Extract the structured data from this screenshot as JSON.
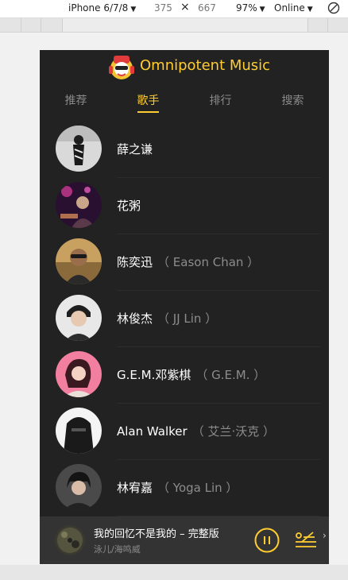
{
  "devtools": {
    "device": "iPhone 6/7/8",
    "width": "375",
    "times": "×",
    "height": "667",
    "zoom": "97%",
    "network": "Online",
    "caret": "▼"
  },
  "app": {
    "title": "Omnipotent Music"
  },
  "tabs": [
    {
      "label": "推荐"
    },
    {
      "label": "歌手"
    },
    {
      "label": "排行"
    },
    {
      "label": "搜索"
    }
  ],
  "active_tab": "歌手",
  "singers": [
    {
      "name": "薛之谦",
      "alias": ""
    },
    {
      "name": "花粥",
      "alias": ""
    },
    {
      "name": "陈奕迅",
      "alias": "（ Eason Chan ）"
    },
    {
      "name": "林俊杰",
      "alias": "（ JJ Lin ）"
    },
    {
      "name": "G.E.M.邓紫棋",
      "alias": "（ G.E.M. ）"
    },
    {
      "name": "Alan Walker",
      "alias": "（ 艾兰·沃克 ）"
    },
    {
      "name": "林宥嘉",
      "alias": "（ Yoga Lin ）"
    }
  ],
  "player": {
    "song": "我的回忆不是我的 – 完整版",
    "artist": "泳儿/海鸣威"
  },
  "colors": {
    "accent": "#ffcd32",
    "background": "#222222",
    "player_bg": "#333333"
  }
}
